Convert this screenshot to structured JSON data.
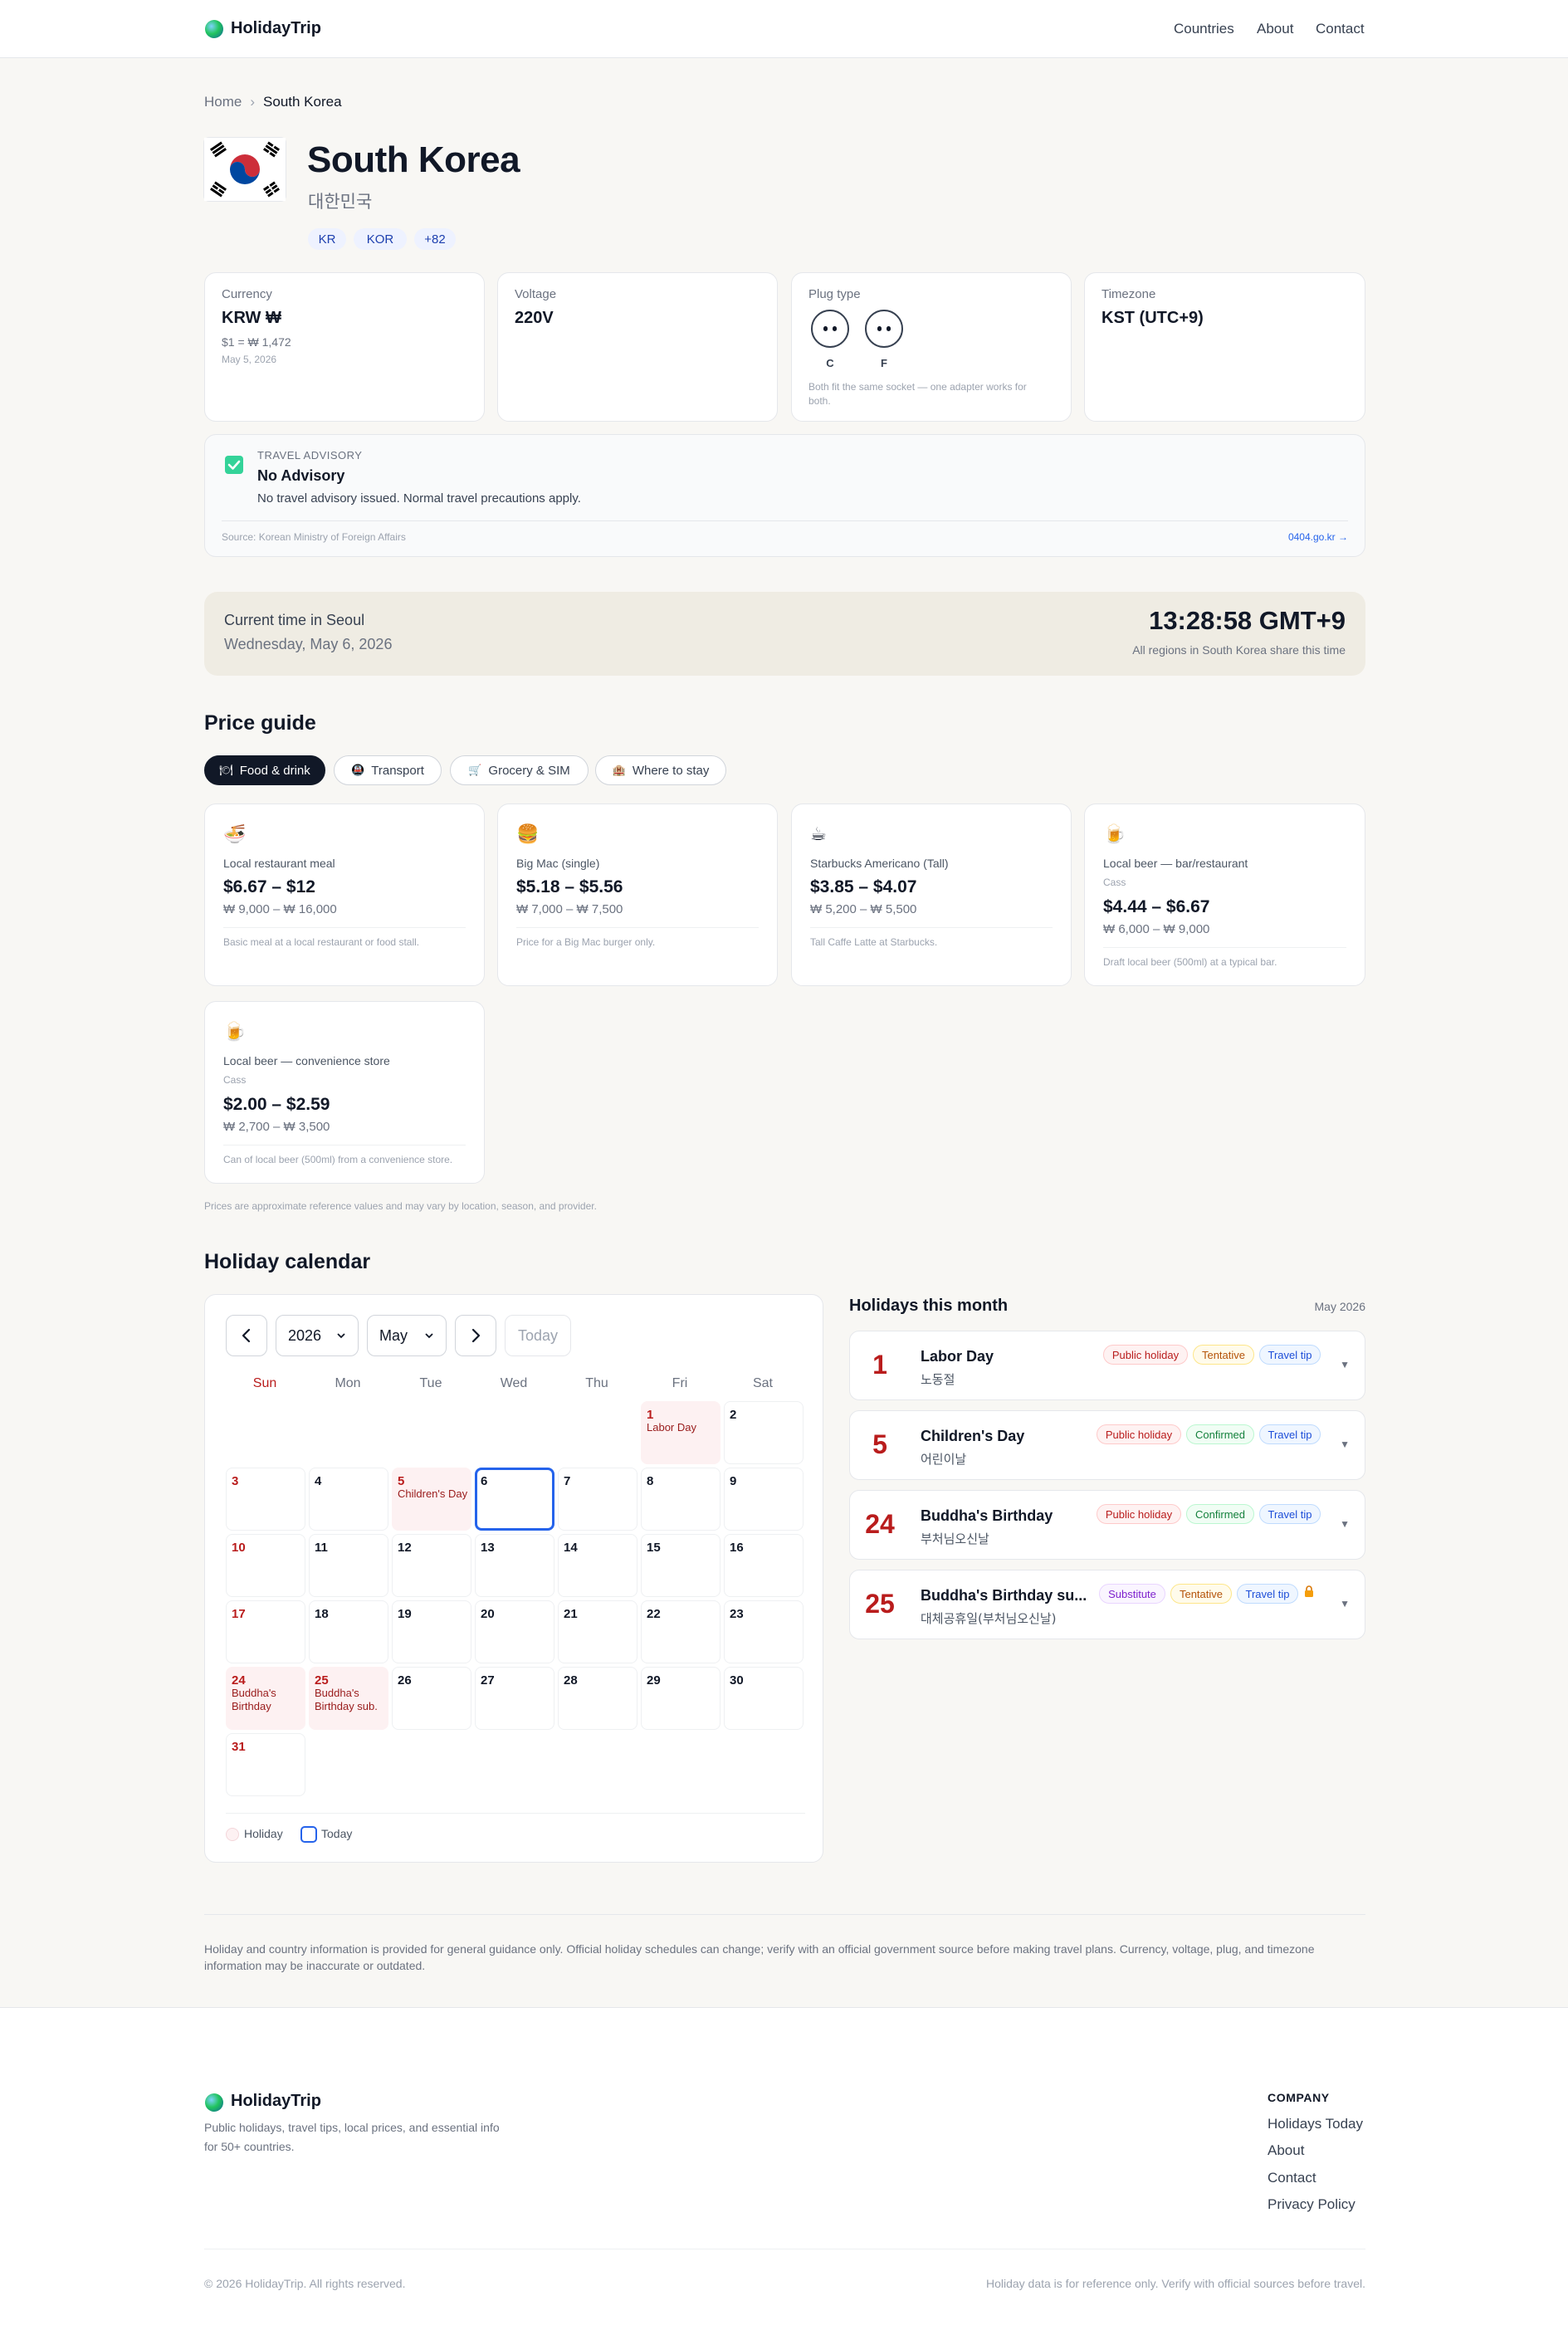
{
  "header": {
    "brand": "HolidayTrip",
    "nav": [
      "Countries",
      "About",
      "Contact"
    ]
  },
  "breadcrumb": {
    "home": "Home",
    "separator": "›",
    "current": "South Korea"
  },
  "country": {
    "name": "South Korea",
    "native_name": "대한민국",
    "codes": [
      "KR",
      "KOR",
      "+82"
    ]
  },
  "info": {
    "currency": {
      "label": "Currency",
      "value": "KRW ₩",
      "rate": "$1 = ₩ 1,472",
      "date": "May 5, 2026"
    },
    "voltage": {
      "label": "Voltage",
      "value": "220V"
    },
    "plug": {
      "label": "Plug type",
      "types": [
        "C",
        "F"
      ],
      "note": "Both fit the same socket — one adapter works for both."
    },
    "timezone": {
      "label": "Timezone",
      "value": "KST (UTC+9)"
    }
  },
  "advisory": {
    "kicker": "TRAVEL ADVISORY",
    "title": "No Advisory",
    "text": "No travel advisory issued. Normal travel precautions apply.",
    "source": "Source: Korean Ministry of Foreign Affairs",
    "link": "0404.go.kr →"
  },
  "clock": {
    "label": "Current time in Seoul",
    "date": "Wednesday, May 6, 2026",
    "time": "13:28:58 GMT+9",
    "note": "All regions in South Korea share this time"
  },
  "prices": {
    "title": "Price guide",
    "tabs": [
      {
        "icon": "🍽",
        "label": "Food & drink",
        "active": true
      },
      {
        "icon": "🚇",
        "label": "Transport",
        "active": false
      },
      {
        "icon": "🛒",
        "label": "Grocery & SIM",
        "active": false
      },
      {
        "icon": "🏨",
        "label": "Where to stay",
        "active": false
      }
    ],
    "items": [
      {
        "icon": "🍜",
        "name": "Local restaurant meal",
        "sub": "",
        "usd": "$6.67 – $12",
        "krw": "₩ 9,000 – ₩ 16,000",
        "note": "Basic meal at a local restaurant or food stall."
      },
      {
        "icon": "🍔",
        "name": "Big Mac (single)",
        "sub": "",
        "usd": "$5.18 – $5.56",
        "krw": "₩ 7,000 – ₩ 7,500",
        "note": "Price for a Big Mac burger only."
      },
      {
        "icon": "☕",
        "name": "Starbucks Americano (Tall)",
        "sub": "",
        "usd": "$3.85 – $4.07",
        "krw": "₩ 5,200 – ₩ 5,500",
        "note": "Tall Caffe Latte at Starbucks."
      },
      {
        "icon": "🍺",
        "name": "Local beer — bar/restaurant",
        "sub": "Cass",
        "usd": "$4.44 – $6.67",
        "krw": "₩ 6,000 – ₩ 9,000",
        "note": "Draft local beer (500ml) at a typical bar."
      },
      {
        "icon": "🍺",
        "name": "Local beer — convenience store",
        "sub": "Cass",
        "usd": "$2.00 – $2.59",
        "krw": "₩ 2,700 – ₩ 3,500",
        "note": "Can of local beer (500ml) from a convenience store."
      }
    ],
    "disclaimer": "Prices are approximate reference values and may vary by location, season, and provider."
  },
  "calendar": {
    "title": "Holiday calendar",
    "year": "2026",
    "month": "May",
    "today_btn": "Today",
    "weekdays": [
      "Sun",
      "Mon",
      "Tue",
      "Wed",
      "Thu",
      "Fri",
      "Sat"
    ],
    "holidays": {
      "1": "Labor Day",
      "5": "Children's Day",
      "24": "Buddha's Birthday",
      "25": "Buddha's Birthday sub."
    },
    "today": 6,
    "legend": {
      "holiday": "Holiday",
      "today": "Today"
    }
  },
  "holiday_list": {
    "title": "Holidays this month",
    "month": "May 2026",
    "items": [
      {
        "day": "1",
        "name": "Labor Day",
        "local": "노동절",
        "type": "Public holiday",
        "status": "Tentative",
        "tip": "Travel tip"
      },
      {
        "day": "5",
        "name": "Children's Day",
        "local": "어린이날",
        "type": "Public holiday",
        "status": "Confirmed",
        "tip": "Travel tip"
      },
      {
        "day": "24",
        "name": "Buddha's Birthday",
        "local": "부처님오신날",
        "type": "Public holiday",
        "status": "Confirmed",
        "tip": "Travel tip"
      },
      {
        "day": "25",
        "name": "Buddha's Birthday su...",
        "local": "대체공휴일(부처님오신날)",
        "type": "Substitute",
        "status": "Tentative",
        "tip": "Travel tip"
      }
    ]
  },
  "disclaimer": "Holiday and country information is provided for general guidance only. Official holiday schedules can change; verify with an official government source before making travel plans. Currency, voltage, plug, and timezone information may be inaccurate or outdated.",
  "footer": {
    "brand": "HolidayTrip",
    "tagline_1": "Public holidays, travel tips, local prices, and essential info",
    "tagline_2": "for 50+ countries.",
    "company_heading": "COMPANY",
    "links": [
      "Holidays Today",
      "About",
      "Contact",
      "Privacy Policy"
    ],
    "copyright": "© 2026 HolidayTrip. All rights reserved.",
    "note": "Holiday data is for reference only. Verify with official sources before travel."
  }
}
